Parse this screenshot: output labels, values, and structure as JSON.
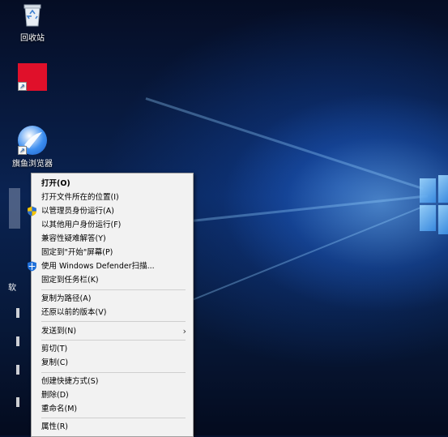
{
  "desktop": {
    "icons": [
      {
        "name": "recycle-bin",
        "label": "回收站"
      },
      {
        "name": "red-app",
        "label": ""
      },
      {
        "name": "browser",
        "label": "旗鱼浏览器"
      },
      {
        "name": "partial",
        "label": "软"
      }
    ]
  },
  "context_menu": {
    "items": {
      "open": "打开(O)",
      "open_location": "打开文件所在的位置(I)",
      "run_as_admin": "以管理员身份运行(A)",
      "run_as_other": "以其他用户身份运行(F)",
      "compat": "兼容性疑难解答(Y)",
      "pin_start": "固定到\"开始\"屏幕(P)",
      "defender": "使用 Windows Defender扫描...",
      "pin_taskbar": "固定到任务栏(K)",
      "copy_path": "复制为路径(A)",
      "restore": "还原以前的版本(V)",
      "send_to": "发送到(N)",
      "cut": "剪切(T)",
      "copy": "复制(C)",
      "create_shortcut": "创建快捷方式(S)",
      "delete": "删除(D)",
      "rename": "重命名(M)",
      "properties": "属性(R)"
    }
  },
  "colors": {
    "menu_bg": "#f2f2f2",
    "shield_blue": "#1e6fd9"
  }
}
